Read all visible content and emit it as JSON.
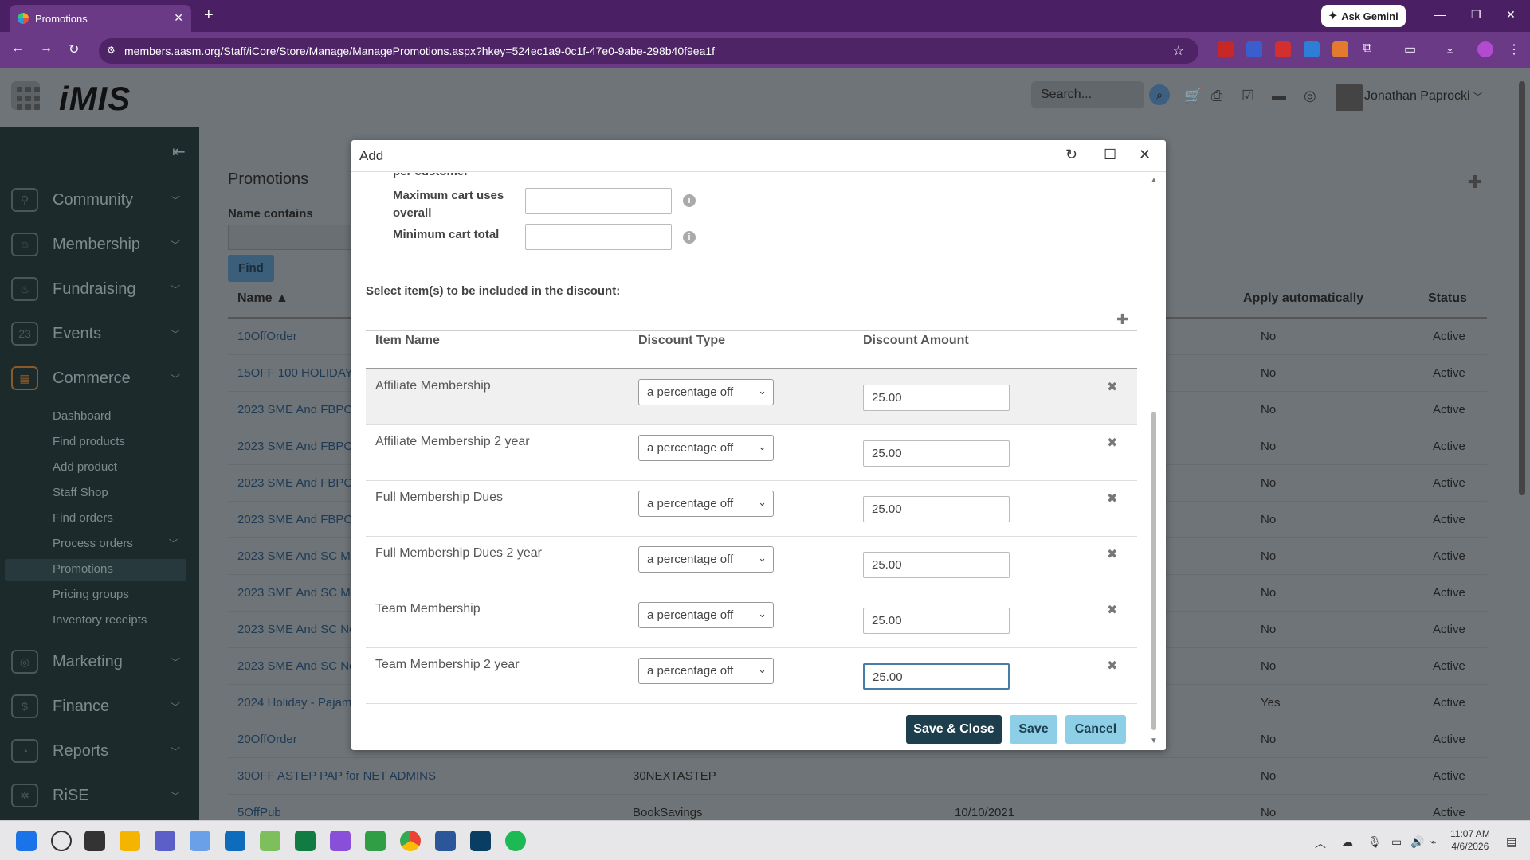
{
  "browser": {
    "tab_title": "Promotions",
    "url": "members.aasm.org/Staff/iCore/Store/Manage/ManagePromotions.aspx?hkey=524ec1a9-0c1f-47e0-9abe-298b40f9ea1f",
    "gemini_label": "Ask Gemini"
  },
  "header": {
    "logo": "iMIS",
    "search_placeholder": "Search...",
    "user_name": "Jonathan Paprocki"
  },
  "sidebar": {
    "items": [
      {
        "label": "Community"
      },
      {
        "label": "Membership"
      },
      {
        "label": "Fundraising"
      },
      {
        "label": "Events"
      },
      {
        "label": "Commerce"
      },
      {
        "label": "Marketing"
      },
      {
        "label": "Finance"
      },
      {
        "label": "Reports"
      },
      {
        "label": "RiSE"
      }
    ],
    "commerce_sub": [
      "Dashboard",
      "Find products",
      "Add product",
      "Staff Shop",
      "Find orders",
      "Process orders",
      "Promotions",
      "Pricing groups",
      "Inventory receipts"
    ]
  },
  "page": {
    "title": "Promotions",
    "name_contains_label": "Name contains",
    "find_label": "Find",
    "col_name": "Name ▲",
    "col_apply": "Apply automatically",
    "col_status": "Status",
    "rows": [
      {
        "name": "10OffOrder",
        "code": "",
        "date": "",
        "apply": "No",
        "status": "Active"
      },
      {
        "name": "15OFF 100 HOLIDAY",
        "code": "",
        "date": "",
        "apply": "No",
        "status": "Active"
      },
      {
        "name": "2023 SME And FBPC",
        "code": "",
        "date": "",
        "apply": "No",
        "status": "Active"
      },
      {
        "name": "2023 SME And FBPC",
        "code": "",
        "date": "",
        "apply": "No",
        "status": "Active"
      },
      {
        "name": "2023 SME And FBPC",
        "code": "",
        "date": "",
        "apply": "No",
        "status": "Active"
      },
      {
        "name": "2023 SME And FBPC",
        "code": "",
        "date": "",
        "apply": "No",
        "status": "Active"
      },
      {
        "name": "2023 SME And SC M",
        "code": "",
        "date": "",
        "apply": "No",
        "status": "Active"
      },
      {
        "name": "2023 SME And SC M",
        "code": "",
        "date": "",
        "apply": "No",
        "status": "Active"
      },
      {
        "name": "2023 SME And SC No",
        "code": "",
        "date": "",
        "apply": "No",
        "status": "Active"
      },
      {
        "name": "2023 SME And SC No",
        "code": "",
        "date": "",
        "apply": "No",
        "status": "Active"
      },
      {
        "name": "2024 Holiday - Pajam",
        "code": "",
        "date": "",
        "apply": "Yes",
        "status": "Active"
      },
      {
        "name": "20OffOrder",
        "code": "",
        "date": "",
        "apply": "No",
        "status": "Active"
      },
      {
        "name": "30OFF ASTEP PAP for NET ADMINS",
        "code": "30NEXTASTEP",
        "date": "",
        "apply": "No",
        "status": "Active"
      },
      {
        "name": "5OffPub",
        "code": "BookSavings",
        "date": "10/10/2021",
        "apply": "No",
        "status": "Active"
      }
    ]
  },
  "dialog": {
    "title": "Add",
    "partial_label": "per customer",
    "max_cart_label": "Maximum cart uses overall",
    "min_cart_label": "Minimum cart total",
    "select_hint": "Select item(s) to be included in the discount:",
    "col_item": "Item Name",
    "col_type": "Discount Type",
    "col_amount": "Discount Amount",
    "items": [
      {
        "name": "Affiliate Membership",
        "type": "a percentage off",
        "amount": "25.00"
      },
      {
        "name": "Affiliate Membership 2 year",
        "type": "a percentage off",
        "amount": "25.00"
      },
      {
        "name": "Full Membership Dues",
        "type": "a percentage off",
        "amount": "25.00"
      },
      {
        "name": "Full Membership Dues 2 year",
        "type": "a percentage off",
        "amount": "25.00"
      },
      {
        "name": "Team Membership",
        "type": "a percentage off",
        "amount": "25.00"
      },
      {
        "name": "Team Membership 2 year",
        "type": "a percentage off",
        "amount": "25.00"
      }
    ],
    "save_close": "Save & Close",
    "save": "Save",
    "cancel": "Cancel"
  },
  "taskbar": {
    "time": "11:07 AM",
    "date": "4/6/2026"
  },
  "colors": {
    "browser_purple": "#4a1f63",
    "save_close_bg": "#1d3f4d",
    "save_bg": "#8ecfe8",
    "accent_blue": "#3b6e9a"
  }
}
